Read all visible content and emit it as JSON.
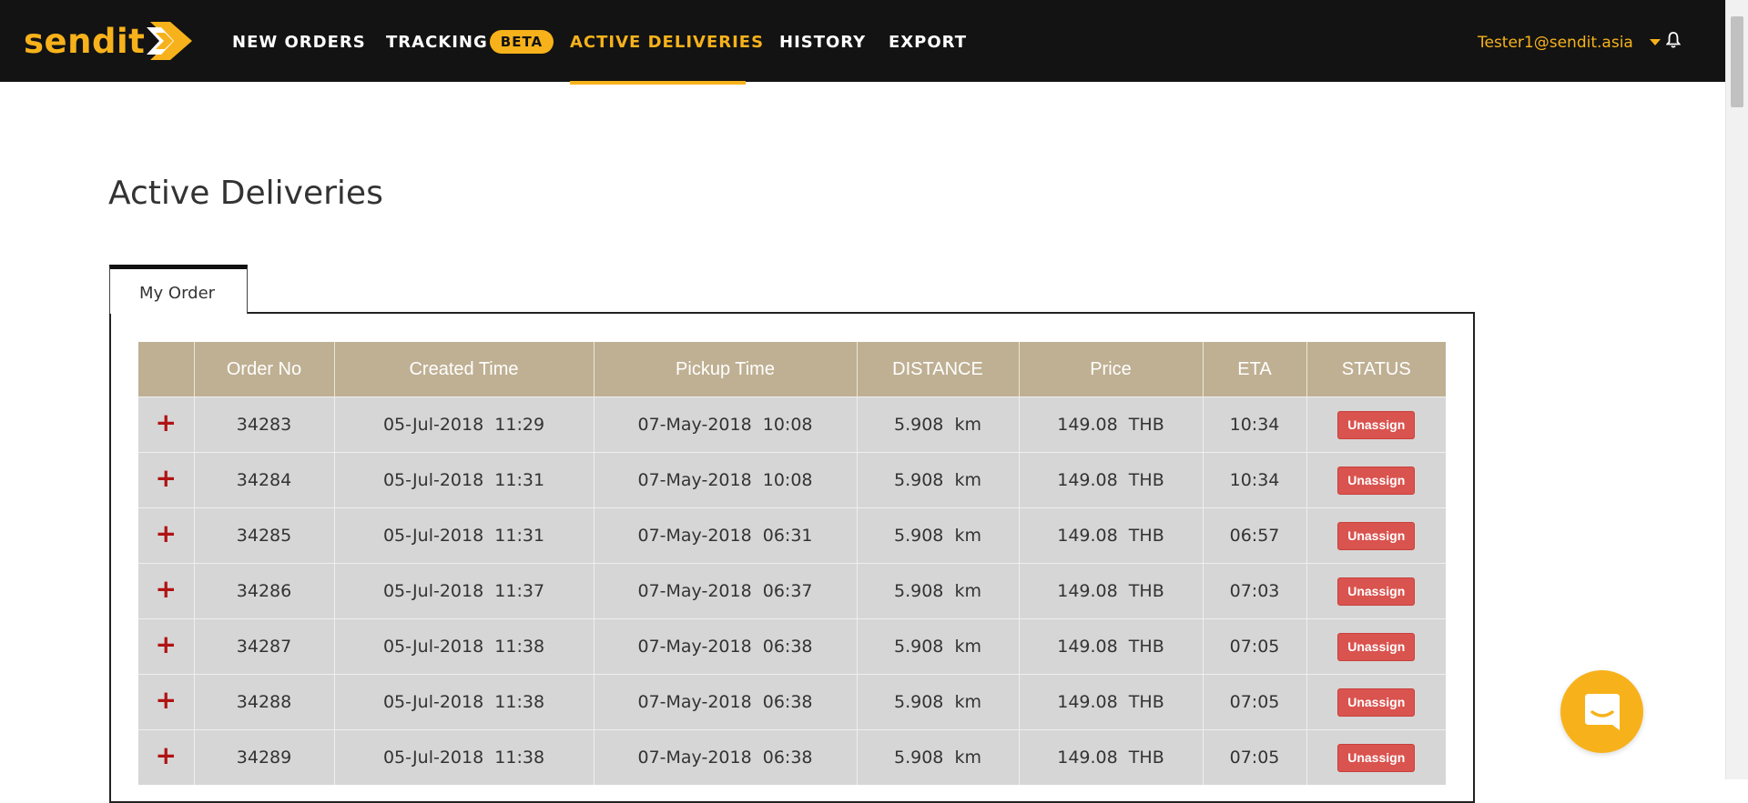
{
  "brand": {
    "logo_text": "sendit",
    "accent_color": "#f7b21b",
    "nav_bg": "#131313"
  },
  "nav": {
    "items": [
      {
        "label": "NEW ORDERS"
      },
      {
        "label": "TRACKING",
        "badge": "BETA"
      },
      {
        "label": "ACTIVE DELIVERIES",
        "active": true
      },
      {
        "label": "HISTORY"
      },
      {
        "label": "EXPORT"
      }
    ],
    "user_email": "Tester1@sendit.asia",
    "bell_icon": "bell-icon"
  },
  "page": {
    "title": "Active Deliveries",
    "tabs": [
      {
        "label": "My Order",
        "active": true
      }
    ]
  },
  "table": {
    "header_color": "#bfb093",
    "row_color": "#d6d6d6",
    "columns": [
      "",
      "Order No",
      "Created Time",
      "Pickup Time",
      "DISTANCE",
      "Price",
      "ETA",
      "STATUS"
    ],
    "rows": [
      {
        "order_no": "34283",
        "created": "05-Jul-2018  11:29",
        "pickup": "07-May-2018  10:08",
        "distance": "5.908  km",
        "price": "149.08  THB",
        "eta": "10:34",
        "status": "Unassign"
      },
      {
        "order_no": "34284",
        "created": "05-Jul-2018  11:31",
        "pickup": "07-May-2018  10:08",
        "distance": "5.908  km",
        "price": "149.08  THB",
        "eta": "10:34",
        "status": "Unassign"
      },
      {
        "order_no": "34285",
        "created": "05-Jul-2018  11:31",
        "pickup": "07-May-2018  06:31",
        "distance": "5.908  km",
        "price": "149.08  THB",
        "eta": "06:57",
        "status": "Unassign"
      },
      {
        "order_no": "34286",
        "created": "05-Jul-2018  11:37",
        "pickup": "07-May-2018  06:37",
        "distance": "5.908  km",
        "price": "149.08  THB",
        "eta": "07:03",
        "status": "Unassign"
      },
      {
        "order_no": "34287",
        "created": "05-Jul-2018  11:38",
        "pickup": "07-May-2018  06:38",
        "distance": "5.908  km",
        "price": "149.08  THB",
        "eta": "07:05",
        "status": "Unassign"
      },
      {
        "order_no": "34288",
        "created": "05-Jul-2018  11:38",
        "pickup": "07-May-2018  06:38",
        "distance": "5.908  km",
        "price": "149.08  THB",
        "eta": "07:05",
        "status": "Unassign"
      },
      {
        "order_no": "34289",
        "created": "05-Jul-2018  11:38",
        "pickup": "07-May-2018  06:38",
        "distance": "5.908  km",
        "price": "149.08  THB",
        "eta": "07:05",
        "status": "Unassign"
      }
    ],
    "expand_symbol": "+",
    "status_color": "#d9534f"
  },
  "chat": {
    "icon": "chat-icon"
  }
}
